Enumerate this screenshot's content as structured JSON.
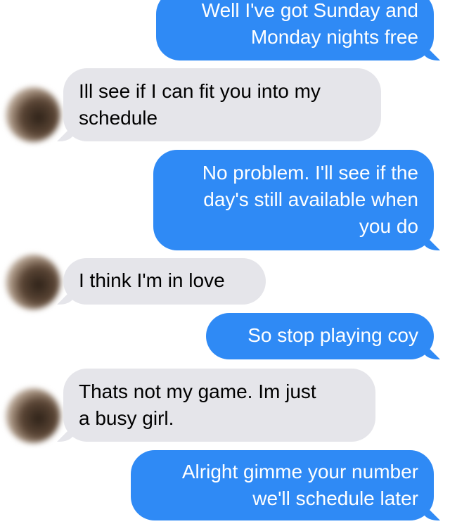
{
  "messages": [
    {
      "id": "m1",
      "direction": "sent",
      "text": "Well I've got Sunday and\nMonday nights free"
    },
    {
      "id": "m2",
      "direction": "received",
      "text": "Ill see if I can fit you into my\nschedule"
    },
    {
      "id": "m3",
      "direction": "sent",
      "text": "No problem. I'll see if the\nday's still available when\nyou do"
    },
    {
      "id": "m4",
      "direction": "received",
      "text": "I think I'm in love"
    },
    {
      "id": "m5",
      "direction": "sent",
      "text": "So stop playing coy"
    },
    {
      "id": "m6",
      "direction": "received",
      "text": "Thats not my game. Im just\na busy girl."
    },
    {
      "id": "m7",
      "direction": "sent",
      "text": "Alright gimme your number\nwe'll schedule later"
    }
  ],
  "colors": {
    "sent_bubble": "#2f8af5",
    "received_bubble": "#e5e5ea",
    "sent_text": "#ffffff",
    "received_text": "#000000"
  }
}
